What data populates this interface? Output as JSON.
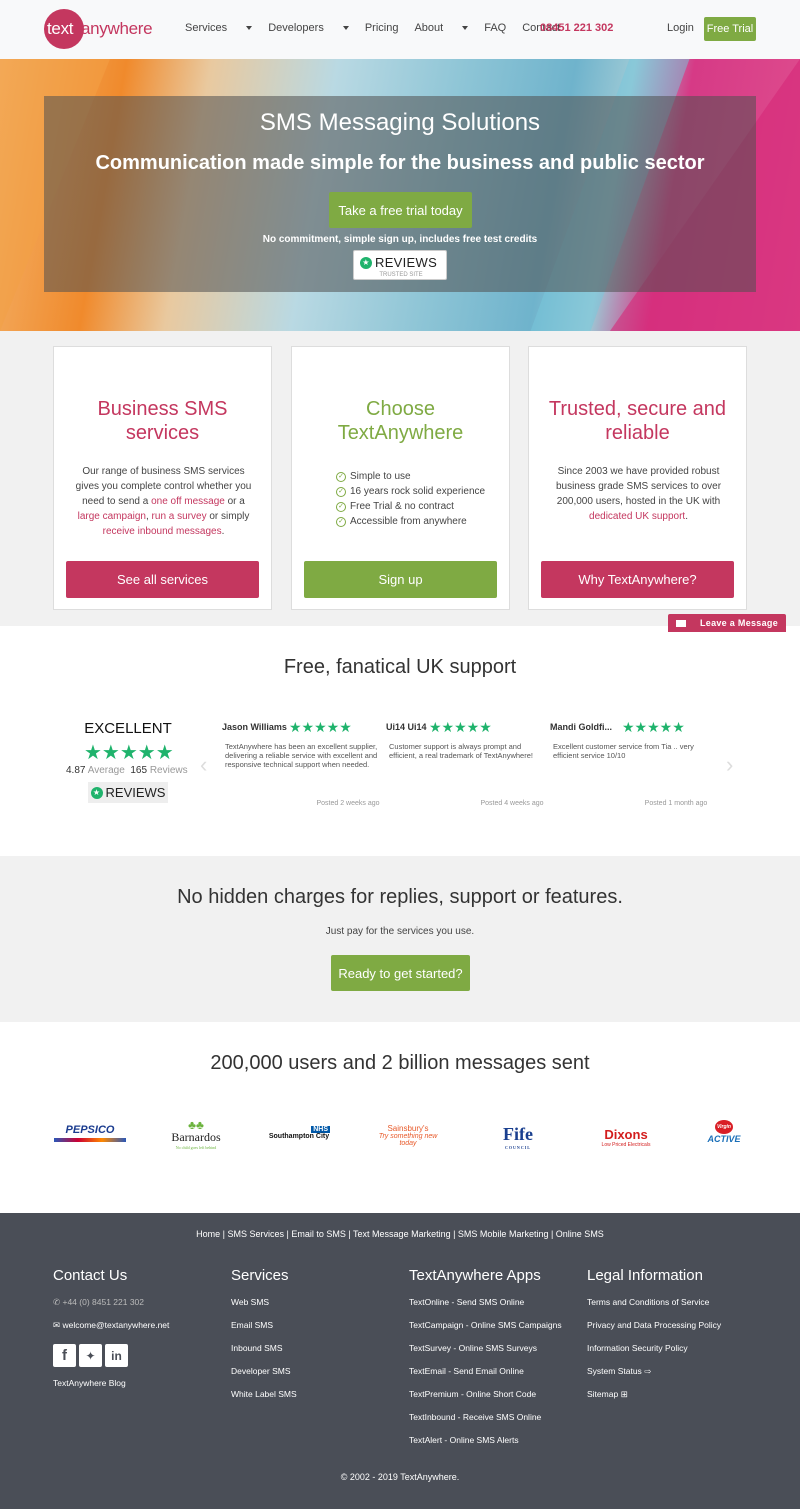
{
  "nav": {
    "logo_part1": "text",
    "logo_part2": "anywhere",
    "links": [
      "Services",
      "Developers",
      "Pricing",
      "About",
      "FAQ",
      "Contact"
    ],
    "phone": "08451 221 302",
    "login": "Login",
    "free_trial": "Free Trial"
  },
  "hero": {
    "title": "SMS Messaging Solutions",
    "subtitle": "Communication made simple for the business and public sector",
    "button": "Take a free trial today",
    "note": "No commitment, simple sign up, includes free test credits",
    "reviews_logo": "REVIEWS",
    "reviews_tag": "TRUSTED SITE"
  },
  "cards": [
    {
      "title": "Business SMS services",
      "body_parts": [
        "Our range of business SMS services gives you complete control whether you need to send a ",
        "one off message",
        " or a ",
        "large campaign",
        ", ",
        "run a survey",
        " or simply ",
        "receive inbound messages",
        "."
      ],
      "button": "See all services"
    },
    {
      "title": "Choose TextAnywhere",
      "list": [
        "Simple to use",
        "16 years rock solid experience",
        "Free Trial & no contract",
        "Accessible from anywhere"
      ],
      "button": "Sign up"
    },
    {
      "title": "Trusted, secure and reliable",
      "body_parts": [
        "Since 2003 we have provided robust business grade SMS services to over 200,000 users, hosted in the UK with ",
        "dedicated UK support",
        "."
      ],
      "button": "Why TextAnywhere?"
    }
  ],
  "leave_message": "Leave a Message",
  "support": {
    "title": "Free, fanatical UK support",
    "rating_word": "EXCELLENT",
    "average": "4.87",
    "average_label": "Average",
    "count": "165",
    "count_label": "Reviews",
    "reviews_logo": "REVIEWS",
    "reviews": [
      {
        "name": "Jason Williams",
        "text": "TextAnywhere has been an excellent supplier, delivering a reliable service with excellent and responsive technical support when needed.",
        "posted": "Posted 2 weeks ago"
      },
      {
        "name": "Ui14 Ui14",
        "text": "Customer support is always prompt and efficient, a real trademark of TextAnywhere!",
        "posted": "Posted 4 weeks ago"
      },
      {
        "name": "Mandi Goldfi...",
        "text": "Excellent customer service from Tia .. very efficient service 10/10",
        "posted": "Posted 1 month ago"
      }
    ]
  },
  "band": {
    "title": "No hidden charges for replies, support or features.",
    "subtitle": "Just pay for the services you use.",
    "button": "Ready to get started?"
  },
  "users": {
    "title": "200,000 users and 2 billion messages sent",
    "clients": [
      "PEPSICO",
      "Barnardos",
      "Southampton City",
      "Sainsbury's",
      "Fife",
      "Dixons",
      "ACTIVE"
    ],
    "client_subs": [
      "",
      "No child goes left behind",
      "",
      "Try something new today",
      "COUNCIL",
      "Low Priced Electricals",
      ""
    ],
    "nhs": "NHS",
    "virgin": "Virgin"
  },
  "footer": {
    "links": "Home | SMS Services | Email to SMS | Text Message Marketing | SMS Mobile Marketing | Online SMS",
    "contact_title": "Contact Us",
    "contact_phone": "+44 (0) 8451 221 302",
    "contact_email": "welcome@textanywhere.net",
    "blog": "TextAnywhere Blog",
    "services_title": "Services",
    "services": [
      "Web SMS",
      "Email SMS",
      "Inbound SMS",
      "Developer SMS",
      "White Label SMS"
    ],
    "apps_title": "TextAnywhere Apps",
    "apps": [
      "TextOnline - Send SMS Online",
      "TextCampaign - Online SMS Campaigns",
      "TextSurvey - Online SMS Surveys",
      "TextEmail - Send Email Online",
      "TextPremium - Online Short Code",
      "TextInbound - Receive SMS Online",
      "TextAlert - Online SMS Alerts"
    ],
    "legal_title": "Legal Information",
    "legal": [
      "Terms and Conditions of Service",
      "Privacy and Data Processing Policy",
      "Information Security Policy",
      "System Status",
      "Sitemap"
    ],
    "copyright": "© 2002 - 2019 TextAnywhere."
  },
  "colors": {
    "brand_pink": "#c4375f",
    "brand_green": "#7faa43",
    "footer_bg": "#4a4e57",
    "star_green": "#1fb36c"
  }
}
